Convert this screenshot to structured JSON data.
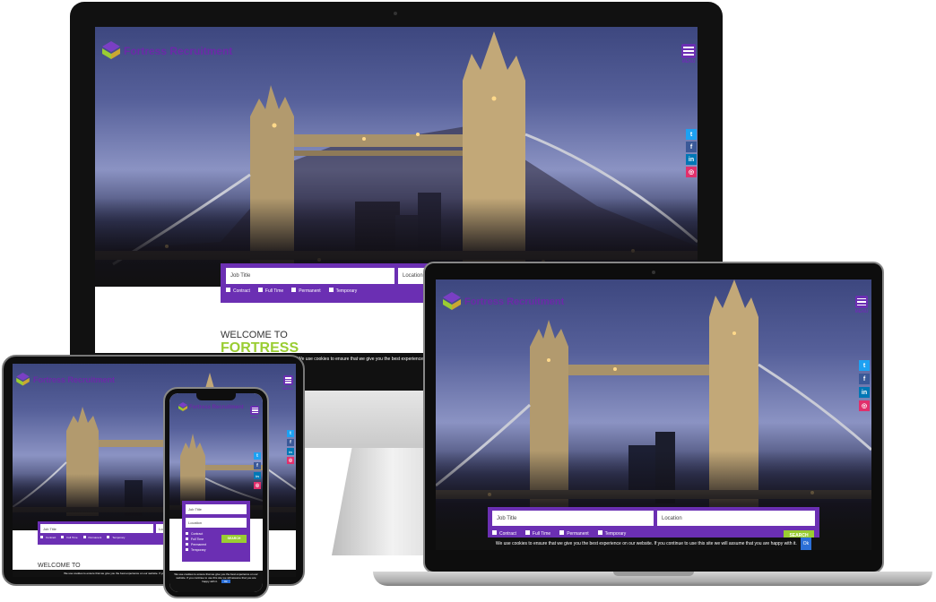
{
  "site": {
    "brand": "Fortress Recruitment",
    "menu_label": "MENU",
    "social": [
      {
        "name": "twitter",
        "glyph": "t",
        "color": "#1da1f2"
      },
      {
        "name": "facebook",
        "glyph": "f",
        "color": "#3b5998"
      },
      {
        "name": "linkedin",
        "glyph": "in",
        "color": "#0077b5"
      },
      {
        "name": "instagram",
        "glyph": "◎",
        "color": "#e1306c"
      }
    ],
    "search": {
      "job_title_placeholder": "Job Title",
      "location_placeholder": "Location",
      "options": [
        "Contract",
        "Full Time",
        "Permanent",
        "Temporary"
      ],
      "search_button": "SEARCH"
    },
    "welcome": "WELCOME TO",
    "fortress": "FORTRESS",
    "cookie_text": "We use cookies to ensure that we give you the best experience on our website. If you continue to use this site we will assume that you are happy with it.",
    "cookie_ok": "Ok",
    "colors": {
      "brand": "#6b2fb3",
      "accent": "#9acd32",
      "logo": "#6b2aa8"
    }
  }
}
